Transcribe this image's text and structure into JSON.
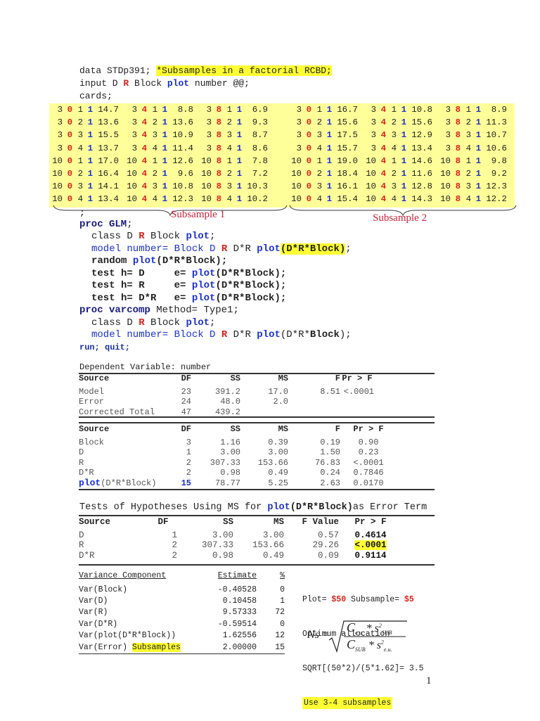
{
  "code_top": {
    "line1_prefix": "data STDp391; ",
    "line1_comment": "*Subsamples in a factorial RCBD;",
    "line2": [
      "input D ",
      "R",
      " Block ",
      "plot",
      " number @@;"
    ],
    "line3": "cards;"
  },
  "data_rows": {
    "subsample1": [
      [
        "3",
        "0",
        "1",
        "1",
        "14.7",
        "3",
        "4",
        "1",
        "1",
        "8.8",
        "3",
        "8",
        "1",
        "1",
        "6.9"
      ],
      [
        "3",
        "0",
        "2",
        "1",
        "13.6",
        "3",
        "4",
        "2",
        "1",
        "13.6",
        "3",
        "8",
        "2",
        "1",
        "9.3"
      ],
      [
        "3",
        "0",
        "3",
        "1",
        "15.5",
        "3",
        "4",
        "3",
        "1",
        "10.9",
        "3",
        "8",
        "3",
        "1",
        "8.7"
      ],
      [
        "3",
        "0",
        "4",
        "1",
        "13.7",
        "3",
        "4",
        "4",
        "1",
        "11.4",
        "3",
        "8",
        "4",
        "1",
        "8.6"
      ],
      [
        "10",
        "0",
        "1",
        "1",
        "17.0",
        "10",
        "4",
        "1",
        "1",
        "12.6",
        "10",
        "8",
        "1",
        "1",
        "7.8"
      ],
      [
        "10",
        "0",
        "2",
        "1",
        "16.4",
        "10",
        "4",
        "2",
        "1",
        "9.6",
        "10",
        "8",
        "2",
        "1",
        "7.2"
      ],
      [
        "10",
        "0",
        "3",
        "1",
        "14.1",
        "10",
        "4",
        "3",
        "1",
        "10.8",
        "10",
        "8",
        "3",
        "1",
        "10.3"
      ],
      [
        "10",
        "0",
        "4",
        "1",
        "13.4",
        "10",
        "4",
        "4",
        "1",
        "12.3",
        "10",
        "8",
        "4",
        "1",
        "10.2"
      ]
    ],
    "subsample2": [
      [
        "3",
        "0",
        "1",
        "1",
        "16.7",
        "3",
        "4",
        "1",
        "1",
        "10.8",
        "3",
        "8",
        "1",
        "1",
        "8.9"
      ],
      [
        "3",
        "0",
        "2",
        "1",
        "15.6",
        "3",
        "4",
        "2",
        "1",
        "15.6",
        "3",
        "8",
        "2",
        "1",
        "11.3"
      ],
      [
        "3",
        "0",
        "3",
        "1",
        "17.5",
        "3",
        "4",
        "3",
        "1",
        "12.9",
        "3",
        "8",
        "3",
        "1",
        "10.7"
      ],
      [
        "3",
        "0",
        "4",
        "1",
        "15.7",
        "3",
        "4",
        "4",
        "1",
        "13.4",
        "3",
        "8",
        "4",
        "1",
        "10.6"
      ],
      [
        "10",
        "0",
        "1",
        "1",
        "19.0",
        "10",
        "4",
        "1",
        "1",
        "14.6",
        "10",
        "8",
        "1",
        "1",
        "9.8"
      ],
      [
        "10",
        "0",
        "2",
        "1",
        "18.4",
        "10",
        "4",
        "2",
        "1",
        "11.6",
        "10",
        "8",
        "2",
        "1",
        "9.2"
      ],
      [
        "10",
        "0",
        "3",
        "1",
        "16.1",
        "10",
        "4",
        "3",
        "1",
        "12.8",
        "10",
        "8",
        "3",
        "1",
        "12.3"
      ],
      [
        "10",
        "0",
        "4",
        "1",
        "15.4",
        "10",
        "4",
        "4",
        "1",
        "14.3",
        "10",
        "8",
        "4",
        "1",
        "12.2"
      ]
    ],
    "label1": "Subsample 1",
    "label2": "Subsample 2"
  },
  "code_bottom": {
    "semicolon": ";",
    "proc_glm": "proc GLM",
    "class_line": [
      "class D ",
      "R",
      " Block ",
      "plot",
      ";"
    ],
    "model_line": [
      "model number= Block D ",
      "R",
      " D*R ",
      "plot",
      "(D*R*Block)",
      ";"
    ],
    "random_line": [
      "random ",
      "plot",
      "(D*R*Block);"
    ],
    "test1": [
      "test h= D     e= ",
      "plot",
      "(D*R*Block);"
    ],
    "test2": [
      "test h= R     e= ",
      "plot",
      "(D*R*Block);"
    ],
    "test3": [
      "test h= D*R   e= ",
      "plot",
      "(D*R*Block);"
    ],
    "proc_varcomp": [
      "proc varcomp",
      " Method= Type1;"
    ],
    "class2_line": [
      "class D ",
      "R",
      " Block ",
      "plot",
      ";"
    ],
    "model2_line": [
      "model number= Block D ",
      "R",
      " D*R ",
      "plot",
      "(D*R*",
      "Block",
      ");"
    ],
    "run": "run; quit;"
  },
  "anova1": {
    "title": "Dependent Variable: number",
    "headers": [
      "Source",
      "DF",
      "SS",
      "MS",
      "F",
      "Pr > F"
    ],
    "rows": [
      [
        "Model",
        "23",
        "391.2",
        "17.0",
        "8.51",
        "<.0001"
      ],
      [
        "Error",
        "24",
        "48.0",
        "2.0",
        "",
        ""
      ],
      [
        "Corrected Total",
        "47",
        "439.2",
        "",
        "",
        ""
      ]
    ]
  },
  "anova2": {
    "headers": [
      "Source",
      "DF",
      "SS",
      "MS",
      "F",
      "Pr > F"
    ],
    "rows": [
      [
        "Block",
        "3",
        "1.16",
        "0.39",
        "0.19",
        "0.90"
      ],
      [
        "D",
        "1",
        "3.00",
        "3.00",
        "1.50",
        "0.23"
      ],
      [
        "R",
        "2",
        "307.33",
        "153.66",
        "76.83",
        "<.0001"
      ],
      [
        "D*R",
        "2",
        "0.98",
        "0.49",
        "0.24",
        "0.7846"
      ]
    ],
    "plot_row": [
      "plot",
      "(D*R*Block)",
      "15",
      "78.77",
      "5.25",
      "2.63",
      "0.0170"
    ]
  },
  "tests": {
    "title_prefix": "Tests of Hypotheses Using MS for ",
    "title_plot": "plot",
    "title_term": "(D*R*Block)",
    "title_suffix": "as Error Term",
    "headers": [
      "Source",
      "DF",
      "SS",
      "MS",
      "F Value",
      "Pr > F"
    ],
    "rows": [
      [
        "D",
        "1",
        "3.00",
        "3.00",
        "0.57",
        "0.4614"
      ],
      [
        "R",
        "2",
        "307.33",
        "153.66",
        "29.26",
        "<.0001"
      ],
      [
        "D*R",
        "2",
        "0.98",
        "0.49",
        "0.09",
        "0.9114"
      ]
    ]
  },
  "varcomp": {
    "headers": [
      "Variance Component",
      "Estimate",
      "%"
    ],
    "rows": [
      [
        "Var(Block)",
        "-0.40528",
        "0"
      ],
      [
        "Var(D)",
        "0.10458",
        "1"
      ],
      [
        "Var(R)",
        "9.57333",
        "72"
      ],
      [
        "Var(D*R)",
        "-0.59514",
        "0"
      ],
      [
        "Var(plot(D*R*Block))",
        "1.62556",
        "12"
      ],
      [
        "Var(Error)",
        "2.00000",
        "15"
      ]
    ],
    "error_note": "Subsamples"
  },
  "allocation": {
    "plot_label": "Plot= ",
    "plot_cost": "$50",
    "sub_label": " Subsample= ",
    "sub_cost": "$5",
    "title": "Optimum allocation",
    "formula_text": "SQRT[(50*2)/(5*1.62]= 3.5",
    "recommendation": "Use 3-4 subsamples",
    "formula_lhs": "Ns =",
    "num_c": "C",
    "num_c_sub": "e.u.",
    "num_s": "s",
    "num_s_sub": "SUB",
    "den_c": "C",
    "den_c_sub": "SUB",
    "den_s": "s",
    "den_s_sub": "e.u.",
    "times": " * ",
    "sq": "2"
  },
  "page_number": "1"
}
